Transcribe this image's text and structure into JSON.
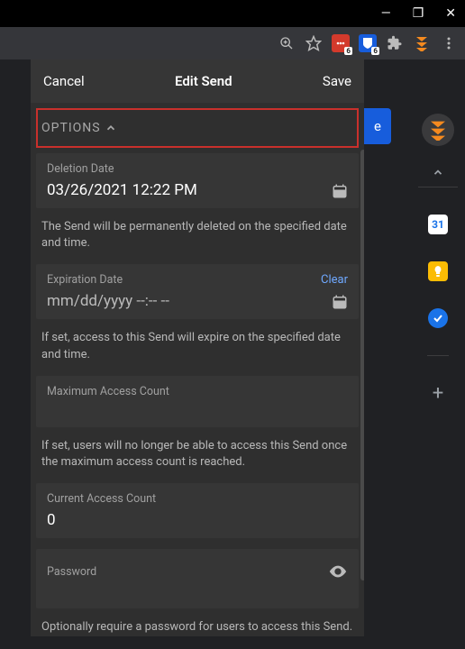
{
  "window": {
    "minimize": "—",
    "maximize": "❐",
    "close": "✕"
  },
  "toolbar": {
    "ext1_badge": "6",
    "ext2_badge": "6"
  },
  "blue_fragment": "e",
  "popup": {
    "cancel": "Cancel",
    "title": "Edit Send",
    "save": "Save",
    "options_label": "OPTIONS",
    "deletion": {
      "label": "Deletion Date",
      "value": "03/26/2021 12:22 PM",
      "help": "The Send will be permanently deleted on the specified date and time."
    },
    "expiration": {
      "label": "Expiration Date",
      "clear": "Clear",
      "placeholder": "mm/dd/yyyy --:-- --",
      "help": "If set, access to this Send will expire on the specified date and time."
    },
    "max_access": {
      "label": "Maximum Access Count",
      "help": "If set, users will no longer be able to access this Send once the maximum access count is reached."
    },
    "current_access": {
      "label": "Current Access Count",
      "value": "0"
    },
    "password": {
      "label": "Password",
      "help": "Optionally require a password for users to access this Send."
    }
  },
  "side": {
    "cal": "31",
    "tasks": "✓",
    "plus": "+"
  }
}
